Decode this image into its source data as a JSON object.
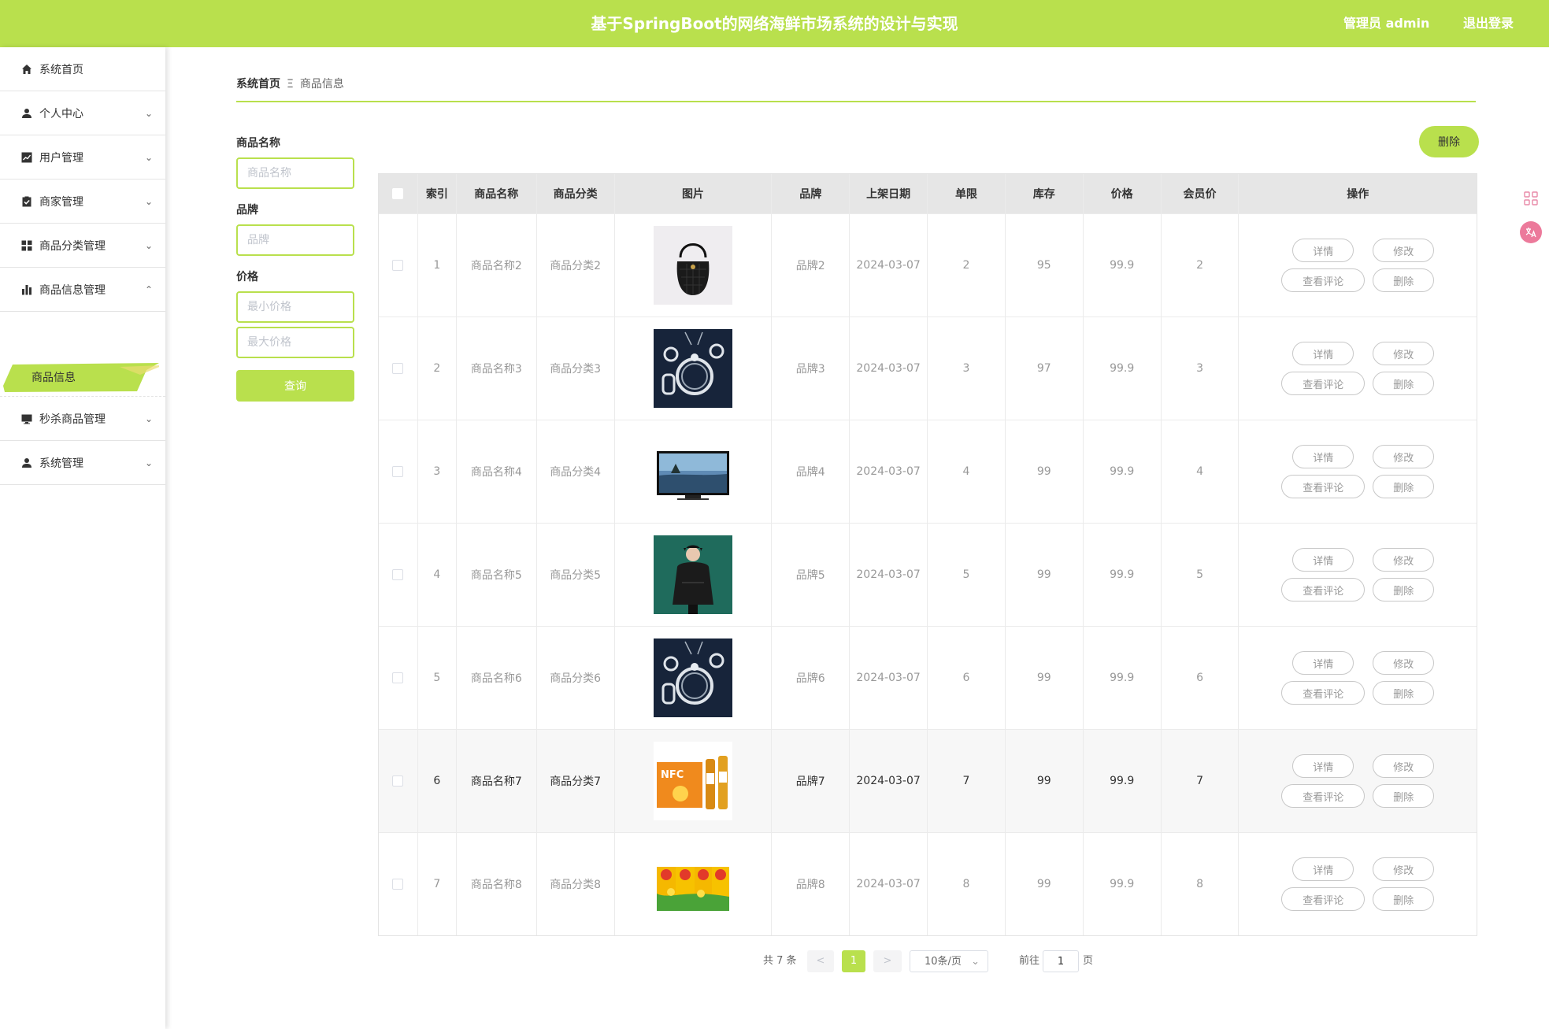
{
  "header": {
    "title": "基于SpringBoot的网络海鲜市场系统的设计与实现",
    "user": "管理员 admin",
    "logout": "退出登录"
  },
  "sidebar": {
    "items": [
      {
        "label": "系统首页",
        "icon": "home-icon"
      },
      {
        "label": "个人中心",
        "icon": "person-icon"
      },
      {
        "label": "用户管理",
        "icon": "chart-line-icon"
      },
      {
        "label": "商家管理",
        "icon": "clipboard-check-icon"
      },
      {
        "label": "商品分类管理",
        "icon": "grid-icon"
      },
      {
        "label": "商品信息管理",
        "icon": "bar-chart-icon"
      },
      {
        "label": "秒杀商品管理",
        "icon": "monitor-icon"
      },
      {
        "label": "系统管理",
        "icon": "person-icon"
      }
    ],
    "active_sub": "商品信息"
  },
  "breadcrumb": {
    "home": "系统首页",
    "sep": "Ξ",
    "current": "商品信息"
  },
  "search": {
    "name_label": "商品名称",
    "name_placeholder": "商品名称",
    "brand_label": "品牌",
    "brand_placeholder": "品牌",
    "price_label": "价格",
    "min_placeholder": "最小价格",
    "max_placeholder": "最大价格",
    "query": "查询"
  },
  "delete_button": "删除",
  "table": {
    "headers": [
      "索引",
      "商品名称",
      "商品分类",
      "图片",
      "品牌",
      "上架日期",
      "单限",
      "库存",
      "价格",
      "会员价",
      "操作"
    ],
    "actions": {
      "detail": "详情",
      "edit": "修改",
      "comments": "查看评论",
      "delete": "删除"
    },
    "rows": [
      {
        "index": "1",
        "name": "商品名称2",
        "category": "商品分类2",
        "image": "black-handbag",
        "brand": "品牌2",
        "date": "2024-03-07",
        "limit": "2",
        "stock": "95",
        "price": "99.9",
        "member_price": "2"
      },
      {
        "index": "2",
        "name": "商品名称3",
        "category": "商品分类3",
        "image": "jewelry-set",
        "brand": "品牌3",
        "date": "2024-03-07",
        "limit": "3",
        "stock": "97",
        "price": "99.9",
        "member_price": "3"
      },
      {
        "index": "3",
        "name": "商品名称4",
        "category": "商品分类4",
        "image": "tv-monitor",
        "brand": "品牌4",
        "date": "2024-03-07",
        "limit": "4",
        "stock": "99",
        "price": "99.9",
        "member_price": "4"
      },
      {
        "index": "4",
        "name": "商品名称5",
        "category": "商品分类5",
        "image": "fashion-model",
        "brand": "品牌5",
        "date": "2024-03-07",
        "limit": "5",
        "stock": "99",
        "price": "99.9",
        "member_price": "5"
      },
      {
        "index": "5",
        "name": "商品名称6",
        "category": "商品分类6",
        "image": "jewelry-set",
        "brand": "品牌6",
        "date": "2024-03-07",
        "limit": "6",
        "stock": "99",
        "price": "99.9",
        "member_price": "6"
      },
      {
        "index": "6",
        "name": "商品名称7",
        "category": "商品分类7",
        "image": "nfc-juice",
        "brand": "品牌7",
        "date": "2024-03-07",
        "limit": "7",
        "stock": "99",
        "price": "99.9",
        "member_price": "7"
      },
      {
        "index": "7",
        "name": "商品名称8",
        "category": "商品分类8",
        "image": "juice-boxes",
        "brand": "品牌8",
        "date": "2024-03-07",
        "limit": "8",
        "stock": "99",
        "price": "99.9",
        "member_price": "8"
      }
    ]
  },
  "pagination": {
    "total": "共 7 条",
    "prev": "<",
    "page": "1",
    "next": ">",
    "page_size": "10条/页",
    "goto_label": "前往",
    "goto_value": "1",
    "goto_suffix": "页"
  },
  "colors": {
    "accent": "#b9e04d"
  }
}
